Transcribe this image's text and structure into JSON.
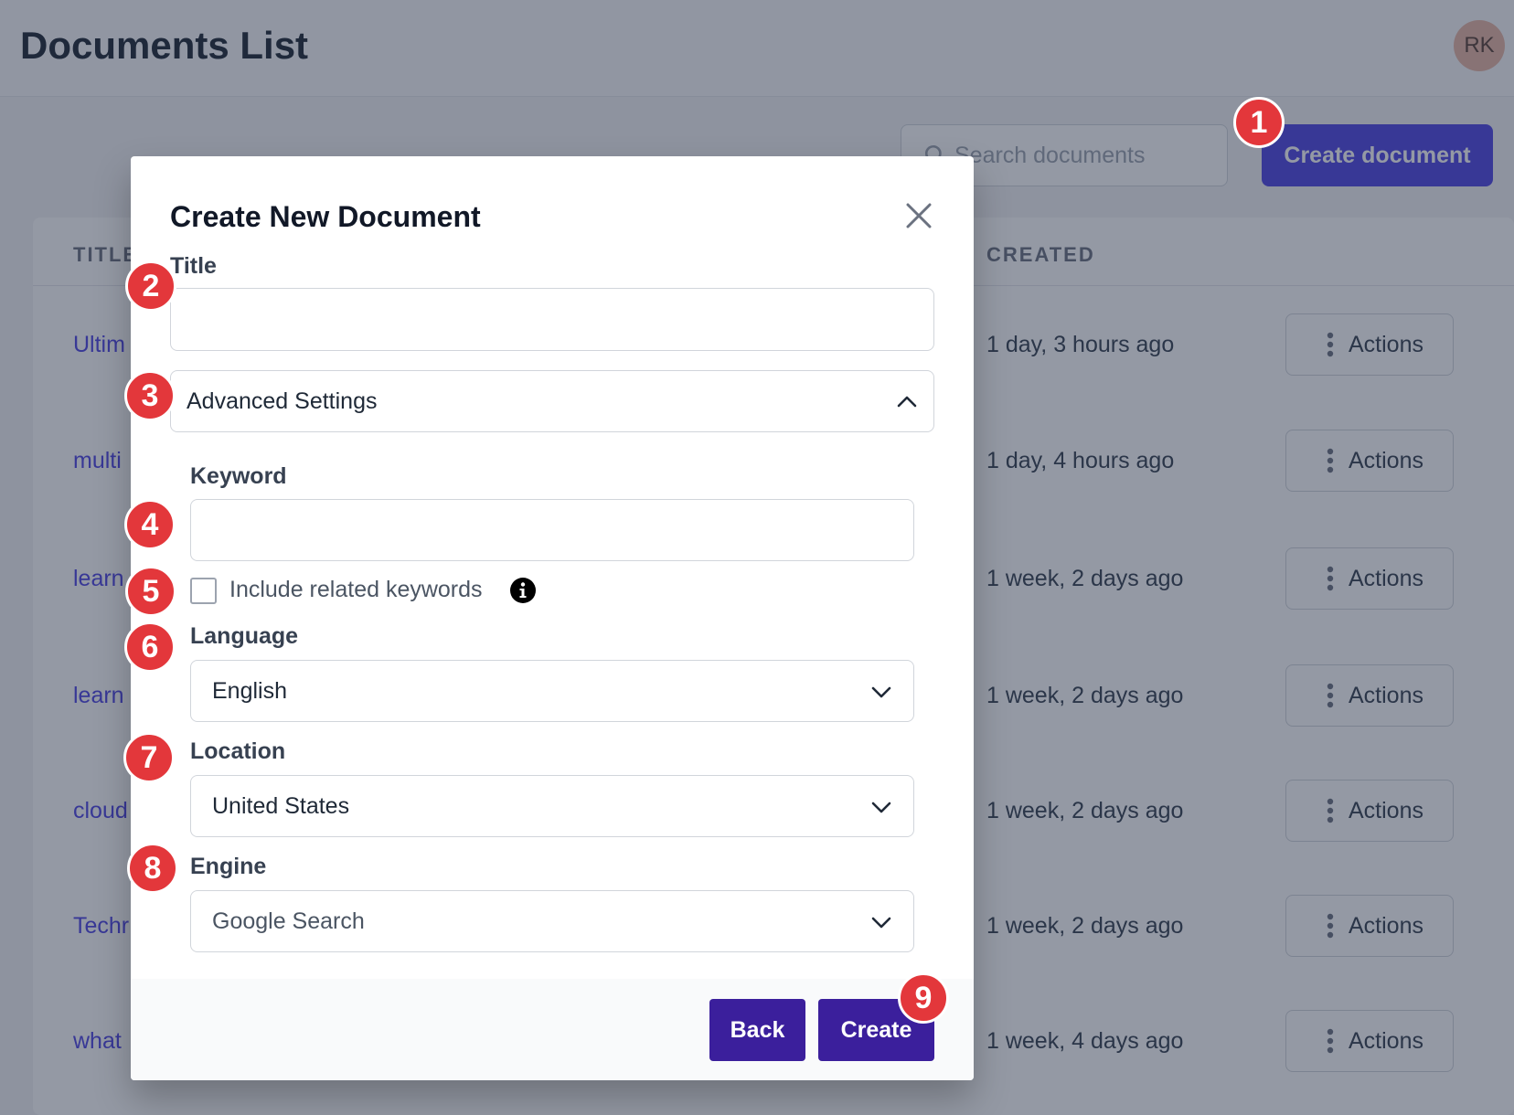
{
  "page": {
    "title": "Documents List",
    "avatar_initials": "RK",
    "search_placeholder": "Search documents",
    "create_button": "Create document"
  },
  "table": {
    "columns": {
      "title": "TITLE",
      "created": "CREATED"
    },
    "action_label": "Actions",
    "rows": [
      {
        "title": "Ultim",
        "created": "1 day, 3 hours ago"
      },
      {
        "title": "multi",
        "created": "1 day, 4 hours ago"
      },
      {
        "title": "learn",
        "created": "1 week, 2 days ago"
      },
      {
        "title": "learn",
        "created": "1 week, 2 days ago"
      },
      {
        "title": "cloud",
        "created": "1 week, 2 days ago"
      },
      {
        "title": "Techr",
        "created": "1 week, 2 days ago"
      },
      {
        "title": "what",
        "created": "1 week, 4 days ago"
      }
    ]
  },
  "modal": {
    "title": "Create New Document",
    "title_label": "Title",
    "title_value": "",
    "advanced_settings": "Advanced Settings",
    "keyword_label": "Keyword",
    "keyword_value": "",
    "include_related": "Include related keywords",
    "include_related_checked": false,
    "language_label": "Language",
    "language_value": "English",
    "location_label": "Location",
    "location_value": "United States",
    "engine_label": "Engine",
    "engine_value": "Google Search",
    "back_button": "Back",
    "create_button": "Create"
  },
  "markers": [
    "1",
    "2",
    "3",
    "4",
    "5",
    "6",
    "7",
    "8",
    "9"
  ],
  "colors": {
    "accent": "#4f46e5",
    "modal_button": "#3b1f9c",
    "marker": "#e3373b"
  }
}
